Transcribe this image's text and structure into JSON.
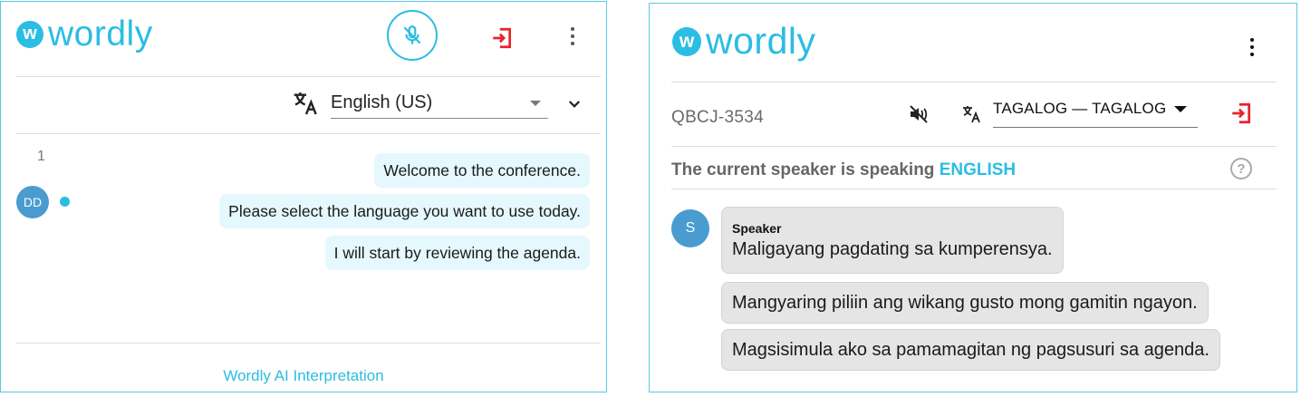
{
  "left_panel": {
    "logo": {
      "badge": "w",
      "text": "wordly"
    },
    "language": {
      "selected": "English (US)"
    },
    "row_number": "1",
    "speaker_initials": "DD",
    "messages": [
      "Welcome to the conference.",
      "Please select the language you want to use today.",
      "I will start by reviewing the agenda."
    ],
    "footer": "Wordly AI Interpretation"
  },
  "right_panel": {
    "logo": {
      "badge": "w",
      "text": "wordly"
    },
    "session_code": "QBCJ-3534",
    "language": {
      "selected": "TAGALOG — TAGALOG"
    },
    "speaking_prefix": "The current speaker is speaking",
    "speaking_language": "ENGLISH",
    "help_glyph": "?",
    "speaker_initial": "S",
    "speaker_name": "Speaker",
    "messages": [
      "Maligayang pagdating sa kumperensya.",
      "Mangyaring piliin ang wikang gusto mong gamitin ngayon.",
      "Magsisimula ako sa pamamagitan ng pagsusuri sa agenda."
    ]
  },
  "colors": {
    "brand": "#2bbde3",
    "exit": "#e8232a",
    "bubble_left": "#e5f8fd",
    "bubble_right": "#e5e5e5",
    "avatar": "#4a9bd0"
  },
  "icons": [
    "mic-off-icon",
    "exit-icon",
    "more-vert-icon",
    "translate-icon",
    "chevron-down-icon",
    "volume-off-icon",
    "help-icon"
  ]
}
